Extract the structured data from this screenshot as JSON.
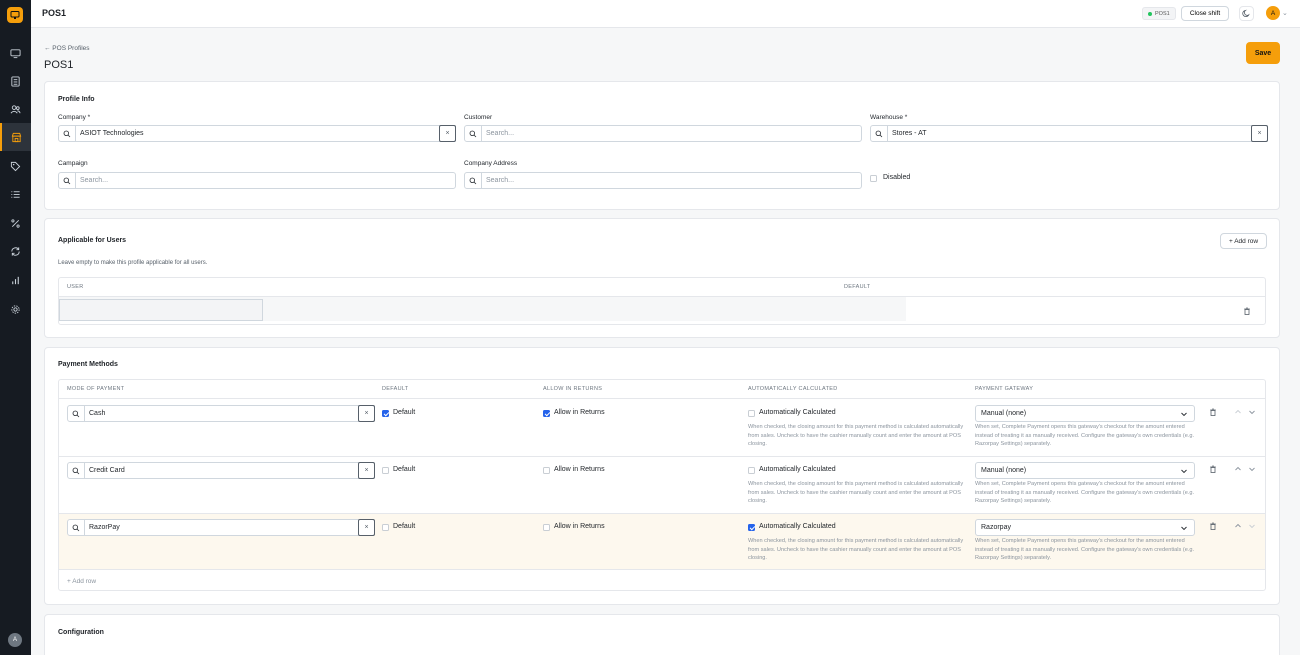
{
  "app": {
    "title": "POS1",
    "pos_badge": "POS1",
    "close_shift": "Close shift",
    "avatar": "A"
  },
  "sidebar": {
    "avatar": "A",
    "items": [
      "pos-terminal",
      "invoices",
      "customers",
      "pos-profiles",
      "promotions",
      "lists",
      "discounts",
      "sync",
      "reports",
      "settings"
    ]
  },
  "header": {
    "breadcrumb": "← POS Profiles",
    "title": "POS1",
    "save": "Save"
  },
  "profile_info": {
    "title": "Profile Info",
    "company": {
      "label": "Company *",
      "value": "ASIOT Technologies"
    },
    "customer": {
      "label": "Customer",
      "placeholder": "Search..."
    },
    "warehouse": {
      "label": "Warehouse *",
      "value": "Stores - AT"
    },
    "campaign": {
      "label": "Campaign",
      "placeholder": "Search..."
    },
    "company_address": {
      "label": "Company Address",
      "placeholder": "Search..."
    },
    "disabled": {
      "label": "Disabled",
      "checked": false
    }
  },
  "users": {
    "title": "Applicable for Users",
    "add_row": "+ Add row",
    "description": "Leave empty to make this profile applicable for all users.",
    "columns": [
      "USER",
      "DEFAULT"
    ]
  },
  "payments": {
    "title": "Payment Methods",
    "columns": [
      "MODE OF PAYMENT",
      "DEFAULT",
      "ALLOW IN RETURNS",
      "AUTOMATICALLY CALCULATED",
      "PAYMENT GATEWAY"
    ],
    "default_label": "Default",
    "returns_label": "Allow in Returns",
    "auto_label": "Automatically Calculated",
    "auto_hint": "When checked, the closing amount for this payment method is calculated automatically from sales. Uncheck to have the cashier manually count and enter the amount at POS closing.",
    "gateway_hint": "When set, Complete Payment opens this gateway's checkout for the amount entered instead of treating it as manually received. Configure the gateway's own credentials (e.g. Razorpay Settings) separately.",
    "rows": [
      {
        "mode": "Cash",
        "default": true,
        "returns": true,
        "auto": false,
        "gateway": "Manual (none)"
      },
      {
        "mode": "Credit Card",
        "default": false,
        "returns": false,
        "auto": false,
        "gateway": "Manual (none)"
      },
      {
        "mode": "RazorPay",
        "default": false,
        "returns": false,
        "auto": true,
        "gateway": "Razorpay"
      }
    ],
    "add_row": "+ Add row"
  },
  "configuration": {
    "title": "Configuration"
  },
  "colors": {
    "accent": "#f59e0b",
    "sidebar": "#161b22",
    "checked": "#2563eb",
    "highlight_row": "#fdf8ee"
  }
}
